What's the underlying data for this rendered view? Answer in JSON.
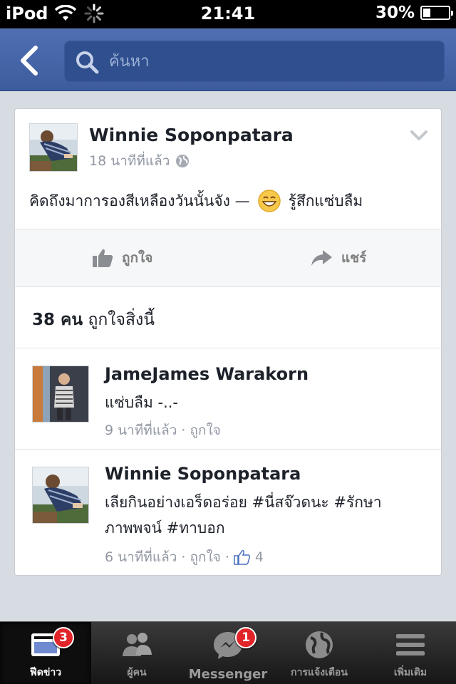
{
  "status_bar": {
    "carrier": "iPod",
    "time": "21:41",
    "battery_percent": "30%",
    "battery_level": 0.3
  },
  "nav": {
    "back_icon": "chevron-left-icon",
    "search_placeholder": "ค้นหา"
  },
  "post": {
    "author": "Winnie Soponpatara",
    "time": "18 นาทีที่แล้ว",
    "privacy_icon": "globe-icon",
    "text": "คิดถึงมาการองสีเหลืองวันนั้นจัง —",
    "feeling": "รู้สึกแซ่บลืม",
    "actions": {
      "like": "ถูกใจ",
      "share": "แชร์"
    },
    "likes_count": "38 คน",
    "likes_suffix": "ถูกใจสิ่งนี้"
  },
  "comments": [
    {
      "name": "JameJames Warakorn",
      "text": "แซ่บลืม -..-",
      "time": "9 นาทีที่แล้ว",
      "like": "ถูกใจ"
    },
    {
      "name": "Winnie Soponpatara",
      "text": "เลียกินอย่างเอร็ดอร่อย #นี่สจ๊วดนะ #รักษาภาพพจน์ #ทาบอก",
      "time": "6 นาทีที่แล้ว",
      "like": "ถูกใจ",
      "like_count": "4"
    }
  ],
  "tabs": [
    {
      "label": "ฟีดข่าว",
      "icon": "news-feed-icon",
      "badge": "3",
      "active": true
    },
    {
      "label": "ผู้คน",
      "icon": "people-icon"
    },
    {
      "label": "Messenger",
      "icon": "messenger-icon",
      "badge": "1"
    },
    {
      "label": "การแจ้งเตือน",
      "icon": "globe-icon"
    },
    {
      "label": "เพิ่มเติม",
      "icon": "menu-icon"
    }
  ],
  "colors": {
    "nav_blue": "#3d5c9e",
    "badge_red": "#e0242a",
    "like_blue": "#4a6fc0"
  }
}
